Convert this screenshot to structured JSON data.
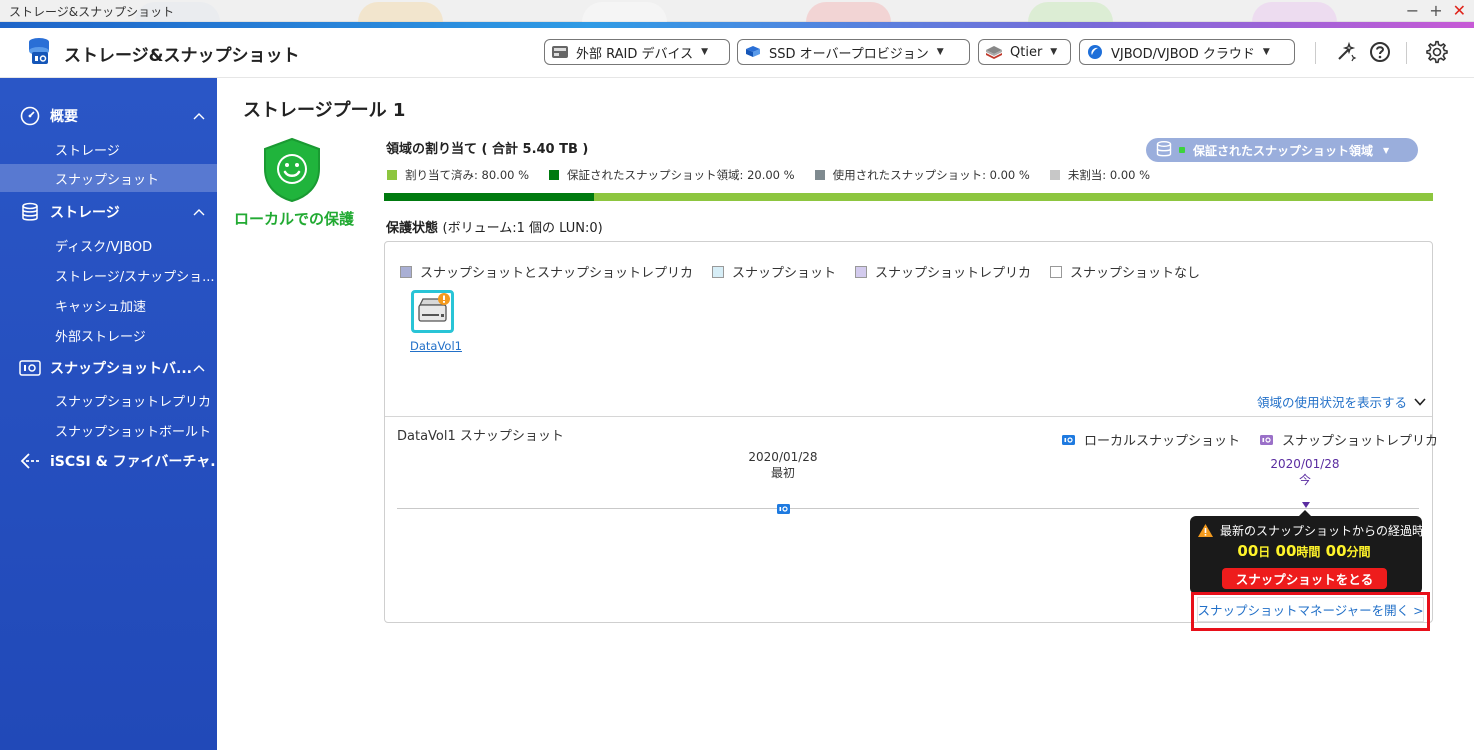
{
  "window": {
    "title": "ストレージ&スナップショット",
    "controls": [
      "−",
      "+",
      "✕"
    ]
  },
  "header": {
    "app_title": "ストレージ&スナップショット",
    "buttons": [
      {
        "label": "外部 RAID デバイス",
        "icon": "raid-icon"
      },
      {
        "label": "SSD オーバープロビジョン",
        "icon": "ssd-icon"
      },
      {
        "label": "Qtier",
        "icon": "qtier-icon"
      },
      {
        "label": "VJBOD/VJBOD クラウド",
        "icon": "vjbod-icon"
      }
    ],
    "right_icons": [
      "magic-wand-icon",
      "help-icon",
      "gear-icon"
    ]
  },
  "sidebar": {
    "sections": [
      {
        "label": "概要",
        "icon": "dashboard-icon",
        "expanded": true,
        "items": [
          {
            "label": "ストレージ"
          },
          {
            "label": "スナップショット",
            "active": true
          }
        ]
      },
      {
        "label": "ストレージ",
        "icon": "database-icon",
        "expanded": true,
        "items": [
          {
            "label": "ディスク/VJBOD"
          },
          {
            "label": "ストレージ/スナップショ..."
          },
          {
            "label": "キャッシュ加速"
          },
          {
            "label": "外部ストレージ"
          }
        ]
      },
      {
        "label": "スナップショットバ...",
        "icon": "snapshot-backup-icon",
        "expanded": true,
        "items": [
          {
            "label": "スナップショットレプリカ"
          },
          {
            "label": "スナップショットボールト"
          }
        ]
      },
      {
        "label": "iSCSI & ファイバーチャ...",
        "icon": "iscsi-icon",
        "expanded": false,
        "items": []
      }
    ]
  },
  "main": {
    "pool_title": "ストレージプール 1",
    "protection_badge": "ローカルでの保護",
    "allocation": {
      "title": "領域の割り当て ( 合計 5.40 TB )",
      "dropdown_label": "保証されたスナップショット領域",
      "legend": [
        {
          "label": "割り当て済み: 80.00 %",
          "color": "#8dc63f",
          "value": 80.0
        },
        {
          "label": "保証されたスナップショット領域: 20.00 %",
          "color": "#007a0f",
          "value": 20.0
        },
        {
          "label": "使用されたスナップショット: 0.00 %",
          "color": "#7f8a8f",
          "value": 0.0
        },
        {
          "label": "未割当: 0.00 %",
          "color": "#c7c7c7",
          "value": 0.0
        }
      ]
    },
    "protection": {
      "title": "保護状態",
      "subtitle": "(ボリューム:1 個の LUN:0)",
      "legend": [
        {
          "label": "スナップショットとスナップショットレプリカ",
          "color": "#a9afd4"
        },
        {
          "label": "スナップショット",
          "color": "#d7eef7"
        },
        {
          "label": "スナップショットレプリカ",
          "color": "#d3cbee"
        },
        {
          "label": "スナップショットなし",
          "color": "#ffffff"
        }
      ],
      "volume_name": "DataVol1",
      "usage_link": "領域の使用状況を表示する"
    },
    "snapshots": {
      "title": "DataVol1 スナップショット",
      "legend": [
        {
          "label": "ローカルスナップショット",
          "color": "#1e7ae0"
        },
        {
          "label": "スナップショットレプリカ",
          "color": "#9a70c8"
        }
      ],
      "first_date": "2020/01/28",
      "first_label": "最初",
      "now_date": "2020/01/28",
      "now_label": "今",
      "popup": {
        "heading": "最新のスナップショットからの経過時間",
        "days": "00",
        "days_unit": "日",
        "hours": "00",
        "hours_unit": "時間",
        "minutes": "00",
        "minutes_unit": "分間",
        "take_button": "スナップショットをとる"
      },
      "manager_link": "スナップショットマネージャーを開く >"
    }
  }
}
